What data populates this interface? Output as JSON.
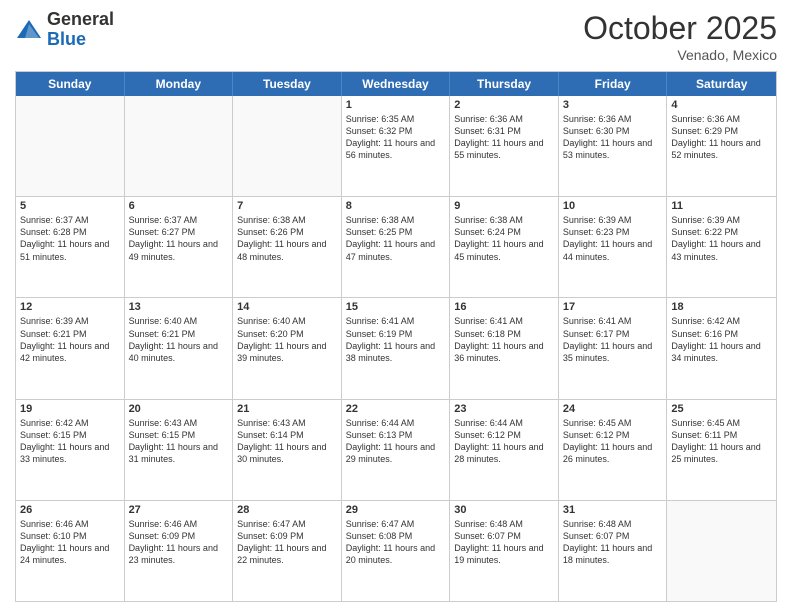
{
  "logo": {
    "general": "General",
    "blue": "Blue"
  },
  "header": {
    "month": "October 2025",
    "location": "Venado, Mexico"
  },
  "weekdays": [
    "Sunday",
    "Monday",
    "Tuesday",
    "Wednesday",
    "Thursday",
    "Friday",
    "Saturday"
  ],
  "rows": [
    [
      {
        "day": "",
        "info": "",
        "empty": true
      },
      {
        "day": "",
        "info": "",
        "empty": true
      },
      {
        "day": "",
        "info": "",
        "empty": true
      },
      {
        "day": "1",
        "info": "Sunrise: 6:35 AM\nSunset: 6:32 PM\nDaylight: 11 hours\nand 56 minutes.",
        "empty": false
      },
      {
        "day": "2",
        "info": "Sunrise: 6:36 AM\nSunset: 6:31 PM\nDaylight: 11 hours\nand 55 minutes.",
        "empty": false
      },
      {
        "day": "3",
        "info": "Sunrise: 6:36 AM\nSunset: 6:30 PM\nDaylight: 11 hours\nand 53 minutes.",
        "empty": false
      },
      {
        "day": "4",
        "info": "Sunrise: 6:36 AM\nSunset: 6:29 PM\nDaylight: 11 hours\nand 52 minutes.",
        "empty": false
      }
    ],
    [
      {
        "day": "5",
        "info": "Sunrise: 6:37 AM\nSunset: 6:28 PM\nDaylight: 11 hours\nand 51 minutes.",
        "empty": false
      },
      {
        "day": "6",
        "info": "Sunrise: 6:37 AM\nSunset: 6:27 PM\nDaylight: 11 hours\nand 49 minutes.",
        "empty": false
      },
      {
        "day": "7",
        "info": "Sunrise: 6:38 AM\nSunset: 6:26 PM\nDaylight: 11 hours\nand 48 minutes.",
        "empty": false
      },
      {
        "day": "8",
        "info": "Sunrise: 6:38 AM\nSunset: 6:25 PM\nDaylight: 11 hours\nand 47 minutes.",
        "empty": false
      },
      {
        "day": "9",
        "info": "Sunrise: 6:38 AM\nSunset: 6:24 PM\nDaylight: 11 hours\nand 45 minutes.",
        "empty": false
      },
      {
        "day": "10",
        "info": "Sunrise: 6:39 AM\nSunset: 6:23 PM\nDaylight: 11 hours\nand 44 minutes.",
        "empty": false
      },
      {
        "day": "11",
        "info": "Sunrise: 6:39 AM\nSunset: 6:22 PM\nDaylight: 11 hours\nand 43 minutes.",
        "empty": false
      }
    ],
    [
      {
        "day": "12",
        "info": "Sunrise: 6:39 AM\nSunset: 6:21 PM\nDaylight: 11 hours\nand 42 minutes.",
        "empty": false
      },
      {
        "day": "13",
        "info": "Sunrise: 6:40 AM\nSunset: 6:21 PM\nDaylight: 11 hours\nand 40 minutes.",
        "empty": false
      },
      {
        "day": "14",
        "info": "Sunrise: 6:40 AM\nSunset: 6:20 PM\nDaylight: 11 hours\nand 39 minutes.",
        "empty": false
      },
      {
        "day": "15",
        "info": "Sunrise: 6:41 AM\nSunset: 6:19 PM\nDaylight: 11 hours\nand 38 minutes.",
        "empty": false
      },
      {
        "day": "16",
        "info": "Sunrise: 6:41 AM\nSunset: 6:18 PM\nDaylight: 11 hours\nand 36 minutes.",
        "empty": false
      },
      {
        "day": "17",
        "info": "Sunrise: 6:41 AM\nSunset: 6:17 PM\nDaylight: 11 hours\nand 35 minutes.",
        "empty": false
      },
      {
        "day": "18",
        "info": "Sunrise: 6:42 AM\nSunset: 6:16 PM\nDaylight: 11 hours\nand 34 minutes.",
        "empty": false
      }
    ],
    [
      {
        "day": "19",
        "info": "Sunrise: 6:42 AM\nSunset: 6:15 PM\nDaylight: 11 hours\nand 33 minutes.",
        "empty": false
      },
      {
        "day": "20",
        "info": "Sunrise: 6:43 AM\nSunset: 6:15 PM\nDaylight: 11 hours\nand 31 minutes.",
        "empty": false
      },
      {
        "day": "21",
        "info": "Sunrise: 6:43 AM\nSunset: 6:14 PM\nDaylight: 11 hours\nand 30 minutes.",
        "empty": false
      },
      {
        "day": "22",
        "info": "Sunrise: 6:44 AM\nSunset: 6:13 PM\nDaylight: 11 hours\nand 29 minutes.",
        "empty": false
      },
      {
        "day": "23",
        "info": "Sunrise: 6:44 AM\nSunset: 6:12 PM\nDaylight: 11 hours\nand 28 minutes.",
        "empty": false
      },
      {
        "day": "24",
        "info": "Sunrise: 6:45 AM\nSunset: 6:12 PM\nDaylight: 11 hours\nand 26 minutes.",
        "empty": false
      },
      {
        "day": "25",
        "info": "Sunrise: 6:45 AM\nSunset: 6:11 PM\nDaylight: 11 hours\nand 25 minutes.",
        "empty": false
      }
    ],
    [
      {
        "day": "26",
        "info": "Sunrise: 6:46 AM\nSunset: 6:10 PM\nDaylight: 11 hours\nand 24 minutes.",
        "empty": false
      },
      {
        "day": "27",
        "info": "Sunrise: 6:46 AM\nSunset: 6:09 PM\nDaylight: 11 hours\nand 23 minutes.",
        "empty": false
      },
      {
        "day": "28",
        "info": "Sunrise: 6:47 AM\nSunset: 6:09 PM\nDaylight: 11 hours\nand 22 minutes.",
        "empty": false
      },
      {
        "day": "29",
        "info": "Sunrise: 6:47 AM\nSunset: 6:08 PM\nDaylight: 11 hours\nand 20 minutes.",
        "empty": false
      },
      {
        "day": "30",
        "info": "Sunrise: 6:48 AM\nSunset: 6:07 PM\nDaylight: 11 hours\nand 19 minutes.",
        "empty": false
      },
      {
        "day": "31",
        "info": "Sunrise: 6:48 AM\nSunset: 6:07 PM\nDaylight: 11 hours\nand 18 minutes.",
        "empty": false
      },
      {
        "day": "",
        "info": "",
        "empty": true
      }
    ]
  ]
}
